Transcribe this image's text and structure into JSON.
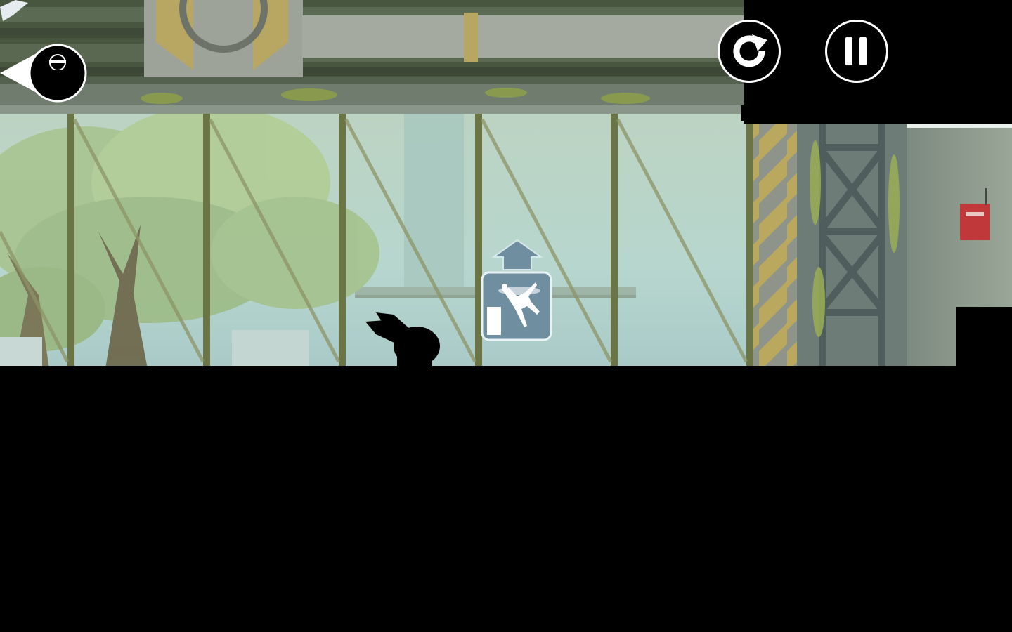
{
  "hud": {
    "back_icon": "back-arrow-hunter-icon",
    "restart_icon": "restart-icon",
    "pause_icon": "pause-icon"
  },
  "trick_prompt": {
    "direction_icon": "swipe-up-arrow-icon",
    "trick_icon": "flip-trick-icon",
    "accent_color": "#6f8fa0"
  },
  "colors": {
    "sky": "#b9d6cc",
    "beam": "#4d5a4a",
    "post": "#6a7343",
    "hazard_yellow": "#b8a65a",
    "foreground": "#000000",
    "alarm_red": "#c0383a"
  }
}
